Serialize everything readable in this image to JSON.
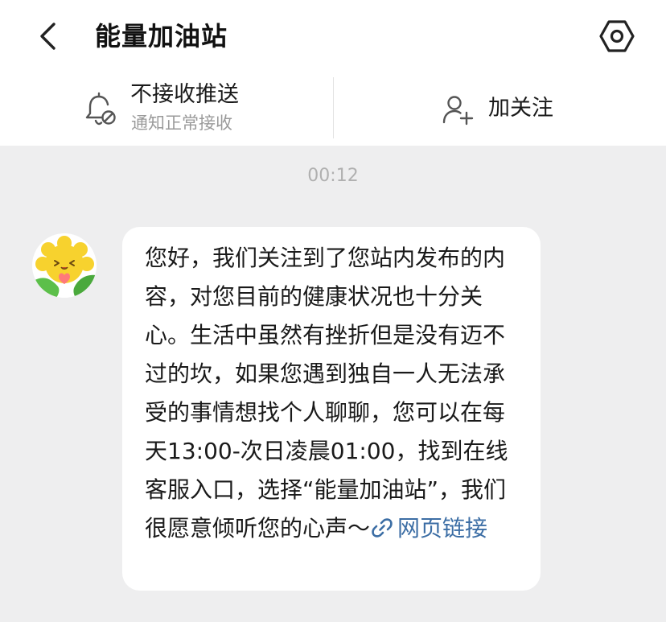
{
  "header": {
    "title": "能量加油站"
  },
  "actions": {
    "push_title": "不接收推送",
    "push_subtitle": "通知正常接收",
    "follow_label": "加关注"
  },
  "chat": {
    "timestamp": "00:12",
    "message": {
      "text": "您好，我们关注到了您站内发布的内容，对您目前的健康状况也十分关心。生活中虽然有挫折但是没有迈不过的坎，如果您遇到独自一人无法承受的事情想找个人聊聊，您可以在每天13:00-次日凌晨01:00，找到在线客服入口，选择“能量加油站”，我们很愿意倾听您的心声～",
      "link_text": "网页链接"
    }
  },
  "icons": {
    "back": "chevron-left-icon",
    "settings": "hexagon-gear-icon",
    "bell": "bell-off-icon",
    "follow": "add-person-icon",
    "link": "link-icon",
    "avatar": "sun-mascot-avatar"
  },
  "colors": {
    "link": "#3c6ea5",
    "page_bg": "#eeeeef",
    "timestamp": "#b0b0b0",
    "avatar_sun": "#f7d22e",
    "avatar_leaf": "#5cbf4a"
  }
}
